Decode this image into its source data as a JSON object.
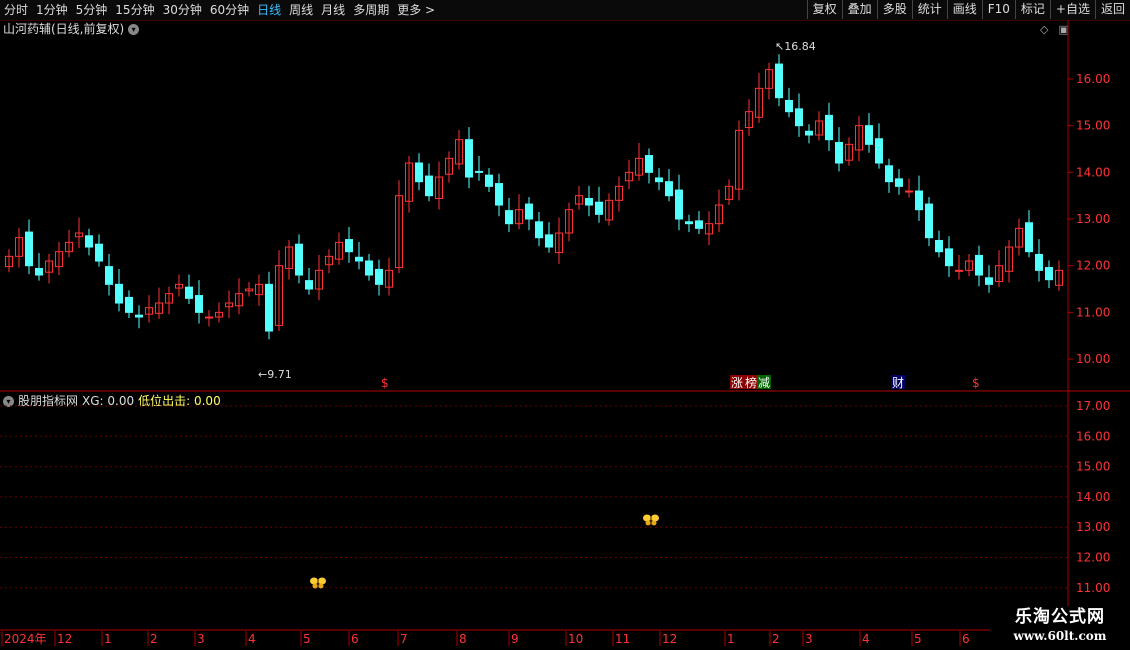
{
  "toolbar": {
    "periods": [
      "分时",
      "1分钟",
      "5分钟",
      "15分钟",
      "30分钟",
      "60分钟",
      "日线",
      "周线",
      "月线",
      "多周期",
      "更多 >"
    ],
    "active_period": "日线",
    "tools": [
      "复权",
      "叠加",
      "多股",
      "统计",
      "画线",
      "F10",
      "标记",
      "+自选",
      "返回"
    ]
  },
  "main_chart": {
    "title": "山河药辅(日线,前复权)",
    "y_ticks": [
      "16.00",
      "15.00",
      "14.00",
      "13.00",
      "12.00",
      "11.00",
      "10.00"
    ],
    "high_label": "16.84",
    "low_label": "9.71",
    "event_markers": [
      "$",
      "涨",
      "榜",
      "减",
      "财",
      "$"
    ]
  },
  "indicator": {
    "name": "股朋指标网",
    "xg_label": "XG: 0.00",
    "low_exit_label": "低位出击: 0.00",
    "y_ticks": [
      "17.00",
      "16.00",
      "15.00",
      "14.00",
      "13.00",
      "12.00",
      "11.00"
    ]
  },
  "time_axis": {
    "labels": [
      "2024年",
      "12",
      "1",
      "2",
      "3",
      "4",
      "5",
      "6",
      "7",
      "8",
      "9",
      "10",
      "11",
      "12",
      "1",
      "2",
      "3",
      "4",
      "5",
      "6"
    ]
  },
  "watermark": {
    "line1": "乐淘公式网",
    "line2": "www.60lt.com"
  },
  "chart_data": {
    "type": "candlestick",
    "ylim": [
      9.5,
      17.0
    ],
    "closes": [
      12.2,
      12.6,
      12.0,
      11.8,
      12.1,
      12.3,
      12.5,
      12.7,
      12.4,
      12.1,
      11.6,
      11.2,
      11.0,
      10.9,
      11.1,
      11.2,
      11.4,
      11.6,
      11.3,
      11.0,
      10.9,
      11.0,
      11.2,
      11.4,
      11.5,
      11.6,
      10.6,
      12.0,
      12.4,
      11.8,
      11.5,
      11.9,
      12.2,
      12.5,
      12.3,
      12.1,
      11.8,
      11.6,
      11.9,
      13.5,
      14.2,
      13.8,
      13.5,
      13.9,
      14.3,
      14.7,
      13.9,
      14.0,
      13.7,
      13.3,
      12.9,
      13.2,
      13.0,
      12.6,
      12.4,
      12.7,
      13.2,
      13.5,
      13.3,
      13.1,
      13.4,
      13.7,
      14.0,
      14.3,
      14.0,
      13.8,
      13.5,
      13.0,
      12.9,
      12.8,
      12.9,
      13.3,
      13.7,
      14.9,
      15.3,
      15.8,
      16.2,
      15.6,
      15.3,
      15.0,
      14.8,
      15.1,
      14.7,
      14.2,
      14.6,
      15.0,
      14.6,
      14.2,
      13.8,
      13.7,
      13.6,
      13.2,
      12.6,
      12.3,
      12.0,
      11.9,
      12.1,
      11.8,
      11.6,
      12.0,
      12.4,
      12.8,
      12.3,
      11.9,
      11.7,
      11.9
    ]
  }
}
